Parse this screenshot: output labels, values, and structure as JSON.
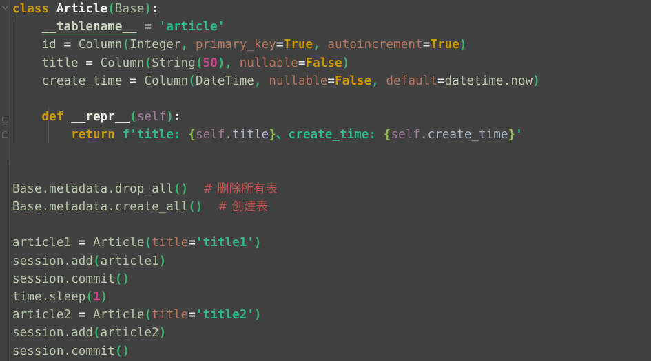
{
  "app": {
    "type": "code-editor",
    "language": "Python",
    "theme": "dark"
  },
  "colors": {
    "background": "#414141",
    "keyword": "#cc9900",
    "string": "#2eb886",
    "number": "#cc4488",
    "comment": "#c05050",
    "kwarg": "#b5775f",
    "identifier": "#a9b7a0",
    "bracket": "#3cb371",
    "self": "#a07d9a",
    "fstring_brace": "#8fbf3f",
    "gutter_icon": "#6f6f6f",
    "indent_guide": "#525252"
  },
  "gutter": {
    "fold_markers": [
      {
        "name": "fold-class-article",
        "state": "expanded",
        "glyph": "chevron-down"
      },
      {
        "name": "fold-method-repr-top",
        "state": "expanded",
        "glyph": "fold-handle"
      },
      {
        "name": "fold-method-repr-bottom",
        "state": "expanded",
        "glyph": "fold-handle"
      }
    ]
  },
  "code": {
    "lines": [
      {
        "n": 1,
        "text": "class Article(Base):",
        "tokens": [
          {
            "t": "class",
            "c": "kw"
          },
          {
            "t": " ",
            "c": "plain"
          },
          {
            "t": "Article",
            "c": "cls"
          },
          {
            "t": "(",
            "c": "punct"
          },
          {
            "t": "Base",
            "c": "base"
          },
          {
            "t": ")",
            "c": "punct"
          },
          {
            "t": ":",
            "c": "colon"
          }
        ]
      },
      {
        "n": 2,
        "text": "    __tablename__ = 'article'",
        "tokens": [
          {
            "t": "    ",
            "c": "plain"
          },
          {
            "t": "__tablename__",
            "c": "dunder"
          },
          {
            "t": " ",
            "c": "plain"
          },
          {
            "t": "=",
            "c": "op"
          },
          {
            "t": " ",
            "c": "plain"
          },
          {
            "t": "'article'",
            "c": "str"
          }
        ]
      },
      {
        "n": 3,
        "text": "    id = Column(Integer, primary_key=True, autoincrement=True)",
        "tokens": [
          {
            "t": "    ",
            "c": "plain"
          },
          {
            "t": "id",
            "c": "ident"
          },
          {
            "t": " ",
            "c": "plain"
          },
          {
            "t": "=",
            "c": "op"
          },
          {
            "t": " ",
            "c": "plain"
          },
          {
            "t": "Column",
            "c": "ident"
          },
          {
            "t": "(",
            "c": "punct"
          },
          {
            "t": "Integer",
            "c": "ident"
          },
          {
            "t": ",",
            "c": "punct"
          },
          {
            "t": " ",
            "c": "plain"
          },
          {
            "t": "primary_key",
            "c": "kwarg"
          },
          {
            "t": "=",
            "c": "op"
          },
          {
            "t": "True",
            "c": "bool"
          },
          {
            "t": ",",
            "c": "punct"
          },
          {
            "t": " ",
            "c": "plain"
          },
          {
            "t": "autoincrement",
            "c": "kwarg"
          },
          {
            "t": "=",
            "c": "op"
          },
          {
            "t": "True",
            "c": "bool"
          },
          {
            "t": ")",
            "c": "punct"
          }
        ]
      },
      {
        "n": 4,
        "text": "    title = Column(String(50), nullable=False)",
        "tokens": [
          {
            "t": "    ",
            "c": "plain"
          },
          {
            "t": "title",
            "c": "ident"
          },
          {
            "t": " ",
            "c": "plain"
          },
          {
            "t": "=",
            "c": "op"
          },
          {
            "t": " ",
            "c": "plain"
          },
          {
            "t": "Column",
            "c": "ident"
          },
          {
            "t": "(",
            "c": "punct"
          },
          {
            "t": "String",
            "c": "ident"
          },
          {
            "t": "(",
            "c": "punct"
          },
          {
            "t": "50",
            "c": "num"
          },
          {
            "t": ")",
            "c": "punct"
          },
          {
            "t": ",",
            "c": "punct"
          },
          {
            "t": " ",
            "c": "plain"
          },
          {
            "t": "nullable",
            "c": "kwarg"
          },
          {
            "t": "=",
            "c": "op"
          },
          {
            "t": "False",
            "c": "bool"
          },
          {
            "t": ")",
            "c": "punct"
          }
        ]
      },
      {
        "n": 5,
        "text": "    create_time = Column(DateTime, nullable=False, default=datetime.now)",
        "tokens": [
          {
            "t": "    ",
            "c": "plain"
          },
          {
            "t": "create_time",
            "c": "ident"
          },
          {
            "t": " ",
            "c": "plain"
          },
          {
            "t": "=",
            "c": "op"
          },
          {
            "t": " ",
            "c": "plain"
          },
          {
            "t": "Column",
            "c": "ident"
          },
          {
            "t": "(",
            "c": "punct"
          },
          {
            "t": "DateTime",
            "c": "ident"
          },
          {
            "t": ",",
            "c": "punct"
          },
          {
            "t": " ",
            "c": "plain"
          },
          {
            "t": "nullable",
            "c": "kwarg"
          },
          {
            "t": "=",
            "c": "op"
          },
          {
            "t": "False",
            "c": "bool"
          },
          {
            "t": ",",
            "c": "punct"
          },
          {
            "t": " ",
            "c": "plain"
          },
          {
            "t": "default",
            "c": "kwarg"
          },
          {
            "t": "=",
            "c": "op"
          },
          {
            "t": "datetime.now",
            "c": "ident"
          },
          {
            "t": ")",
            "c": "punct"
          }
        ]
      },
      {
        "n": 6,
        "text": "",
        "tokens": []
      },
      {
        "n": 7,
        "text": "    def __repr__(self):",
        "tokens": [
          {
            "t": "    ",
            "c": "plain"
          },
          {
            "t": "def",
            "c": "kw"
          },
          {
            "t": " ",
            "c": "plain"
          },
          {
            "t": "__repr__",
            "c": "dundermethod"
          },
          {
            "t": "(",
            "c": "punct"
          },
          {
            "t": "self",
            "c": "self"
          },
          {
            "t": ")",
            "c": "punct"
          },
          {
            "t": ":",
            "c": "colon"
          }
        ]
      },
      {
        "n": 8,
        "text": "        return f'title: {self.title}、create_time: {self.create_time}'",
        "tokens": [
          {
            "t": "        ",
            "c": "plain"
          },
          {
            "t": "return",
            "c": "kw"
          },
          {
            "t": " ",
            "c": "plain"
          },
          {
            "t": "f'title: ",
            "c": "fstrtext"
          },
          {
            "t": "{",
            "c": "brace"
          },
          {
            "t": "self",
            "c": "self"
          },
          {
            "t": ".title",
            "c": "plain"
          },
          {
            "t": "}",
            "c": "brace"
          },
          {
            "t": "、create_time: ",
            "c": "fstrtext"
          },
          {
            "t": "{",
            "c": "brace"
          },
          {
            "t": "self",
            "c": "self"
          },
          {
            "t": ".create_time",
            "c": "plain"
          },
          {
            "t": "}",
            "c": "brace"
          },
          {
            "t": "'",
            "c": "fstrtext"
          }
        ]
      },
      {
        "n": 9,
        "text": "",
        "tokens": []
      },
      {
        "n": 10,
        "text": "",
        "tokens": []
      },
      {
        "n": 11,
        "text": "Base.metadata.drop_all()  # 删除所有表",
        "tokens": [
          {
            "t": "Base.metadata.drop_all",
            "c": "ident"
          },
          {
            "t": "()",
            "c": "punct"
          },
          {
            "t": "  ",
            "c": "plain"
          },
          {
            "t": "# 删除所有表",
            "c": "comment cjk"
          }
        ]
      },
      {
        "n": 12,
        "text": "Base.metadata.create_all()  # 创建表",
        "tokens": [
          {
            "t": "Base.metadata.create_all",
            "c": "ident"
          },
          {
            "t": "()",
            "c": "punct"
          },
          {
            "t": "  ",
            "c": "plain"
          },
          {
            "t": "# 创建表",
            "c": "comment cjk"
          }
        ]
      },
      {
        "n": 13,
        "text": "",
        "tokens": []
      },
      {
        "n": 14,
        "text": "article1 = Article(title='title1')",
        "tokens": [
          {
            "t": "article1",
            "c": "ident"
          },
          {
            "t": " ",
            "c": "plain"
          },
          {
            "t": "=",
            "c": "op"
          },
          {
            "t": " ",
            "c": "plain"
          },
          {
            "t": "Article",
            "c": "ident"
          },
          {
            "t": "(",
            "c": "punct"
          },
          {
            "t": "title",
            "c": "kwarg"
          },
          {
            "t": "=",
            "c": "op"
          },
          {
            "t": "'title1'",
            "c": "str"
          },
          {
            "t": ")",
            "c": "punct"
          }
        ]
      },
      {
        "n": 15,
        "text": "session.add(article1)",
        "tokens": [
          {
            "t": "session.add",
            "c": "ident"
          },
          {
            "t": "(",
            "c": "punct"
          },
          {
            "t": "article1",
            "c": "ident"
          },
          {
            "t": ")",
            "c": "punct"
          }
        ]
      },
      {
        "n": 16,
        "text": "session.commit()",
        "tokens": [
          {
            "t": "session.commit",
            "c": "ident"
          },
          {
            "t": "()",
            "c": "punct"
          }
        ]
      },
      {
        "n": 17,
        "text": "time.sleep(1)",
        "tokens": [
          {
            "t": "time.sleep",
            "c": "ident"
          },
          {
            "t": "(",
            "c": "punct"
          },
          {
            "t": "1",
            "c": "num"
          },
          {
            "t": ")",
            "c": "punct"
          }
        ]
      },
      {
        "n": 18,
        "text": "article2 = Article(title='title2')",
        "tokens": [
          {
            "t": "article2",
            "c": "ident"
          },
          {
            "t": " ",
            "c": "plain"
          },
          {
            "t": "=",
            "c": "op"
          },
          {
            "t": " ",
            "c": "plain"
          },
          {
            "t": "Article",
            "c": "ident"
          },
          {
            "t": "(",
            "c": "punct"
          },
          {
            "t": "title",
            "c": "kwarg"
          },
          {
            "t": "=",
            "c": "op"
          },
          {
            "t": "'title2'",
            "c": "str"
          },
          {
            "t": ")",
            "c": "punct"
          }
        ]
      },
      {
        "n": 19,
        "text": "session.add(article2)",
        "tokens": [
          {
            "t": "session.add",
            "c": "ident"
          },
          {
            "t": "(",
            "c": "punct"
          },
          {
            "t": "article2",
            "c": "ident"
          },
          {
            "t": ")",
            "c": "punct"
          }
        ]
      },
      {
        "n": 20,
        "text": "session.commit()",
        "tokens": [
          {
            "t": "session.commit",
            "c": "ident"
          },
          {
            "t": "()",
            "c": "punct"
          }
        ]
      }
    ]
  }
}
